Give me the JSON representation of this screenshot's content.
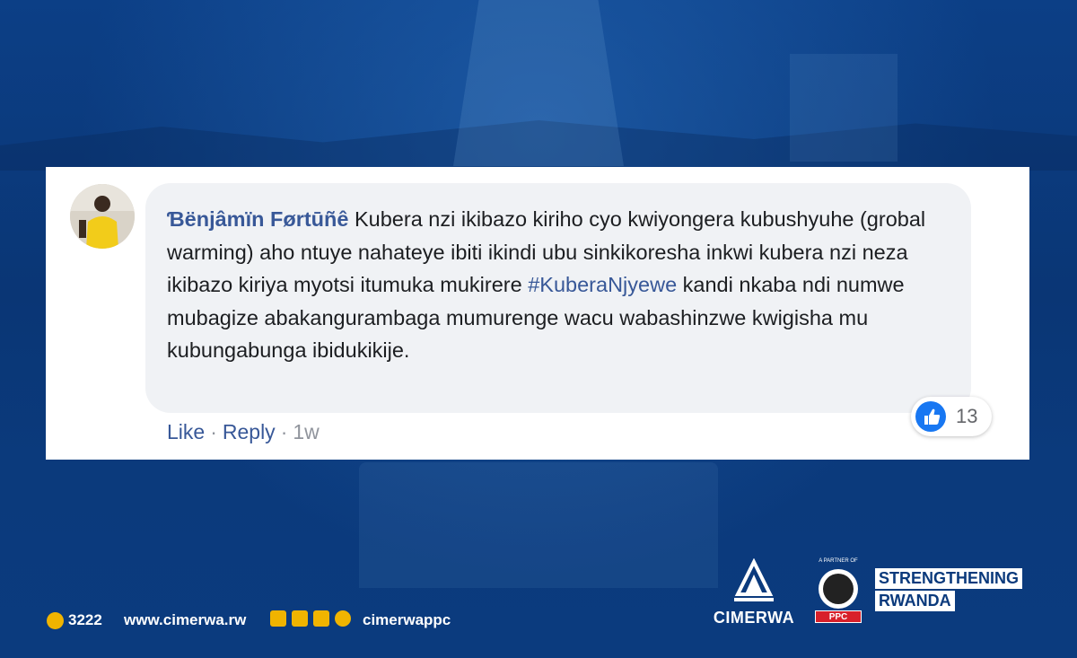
{
  "comment": {
    "author": "Ɓënjâmïn Førtūñê",
    "text_before": " Kubera nzi ikibazo kiriho cyo kwiyongera kubushyuhe (grobal warming) aho ntuye nahateye ibiti ikindi ubu sinkikoresha inkwi kubera nzi neza ikibazo kiriya myotsi itumuka mukirere ",
    "hashtag": "#KuberaNjyewe",
    "text_after": " kandi nkaba ndi numwe mubagize abakangurambaga mumurenge wacu wabashinzwe kwigisha mu kubungabunga ibidukikije.",
    "actions": {
      "like": "Like",
      "sep1": "·",
      "reply": "Reply",
      "sep2": "·",
      "time": "1w"
    },
    "reaction_count": "13"
  },
  "footer": {
    "phone": "3222",
    "website": "www.cimerwa.rw",
    "handle": "cimerwappc"
  },
  "branding": {
    "logo_name": "CIMERWA",
    "partner_label": "A PARTNER OF",
    "partner_name": "PPC",
    "tagline_1": "STRENGTHENING",
    "tagline_2": "RWANDA"
  },
  "colors": {
    "link": "#385898",
    "like_blue": "#1877f2",
    "bg_blue": "#0b3a7c",
    "accent_yellow": "#f0b400"
  },
  "icons": [
    "like-icon",
    "phone-icon",
    "twitter-icon",
    "facebook-icon",
    "linkedin-icon",
    "instagram-icon"
  ]
}
